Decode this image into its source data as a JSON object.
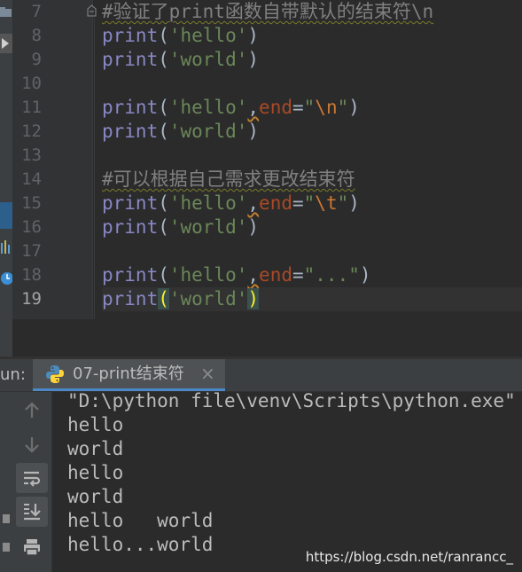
{
  "editor": {
    "line_numbers": [
      "7",
      "8",
      "9",
      "10",
      "11",
      "12",
      "13",
      "14",
      "15",
      "16",
      "17",
      "18",
      "19"
    ],
    "current_line": "19",
    "lines": [
      [
        {
          "t": "#验证了print函数自带默认的结束符\\n",
          "c": "cmt"
        }
      ],
      [
        {
          "t": "print",
          "c": "fn"
        },
        {
          "t": "(",
          "c": ""
        },
        {
          "t": "'hello'",
          "c": "str"
        },
        {
          "t": ")",
          "c": ""
        }
      ],
      [
        {
          "t": "print",
          "c": "fn"
        },
        {
          "t": "(",
          "c": ""
        },
        {
          "t": "'world'",
          "c": "str"
        },
        {
          "t": ")",
          "c": ""
        }
      ],
      [],
      [
        {
          "t": "print",
          "c": "fn"
        },
        {
          "t": "(",
          "c": ""
        },
        {
          "t": "'hello'",
          "c": "str"
        },
        {
          "t": ",",
          "c": "warn"
        },
        {
          "t": "end",
          "c": "kw"
        },
        {
          "t": "=",
          "c": ""
        },
        {
          "t": "\"",
          "c": "str"
        },
        {
          "t": "\\n",
          "c": "esc"
        },
        {
          "t": "\"",
          "c": "str"
        },
        {
          "t": ")",
          "c": ""
        }
      ],
      [
        {
          "t": "print",
          "c": "fn"
        },
        {
          "t": "(",
          "c": ""
        },
        {
          "t": "'world'",
          "c": "str"
        },
        {
          "t": ")",
          "c": ""
        }
      ],
      [],
      [
        {
          "t": "#可以根据自己需求更改结束符",
          "c": "cmt"
        }
      ],
      [
        {
          "t": "print",
          "c": "fn"
        },
        {
          "t": "(",
          "c": ""
        },
        {
          "t": "'hello'",
          "c": "str"
        },
        {
          "t": ",",
          "c": "warn"
        },
        {
          "t": "end",
          "c": "kw"
        },
        {
          "t": "=",
          "c": ""
        },
        {
          "t": "\"",
          "c": "str"
        },
        {
          "t": "\\t",
          "c": "esc"
        },
        {
          "t": "\"",
          "c": "str"
        },
        {
          "t": ")",
          "c": ""
        }
      ],
      [
        {
          "t": "print",
          "c": "fn"
        },
        {
          "t": "(",
          "c": ""
        },
        {
          "t": "'world'",
          "c": "str"
        },
        {
          "t": ")",
          "c": ""
        }
      ],
      [],
      [
        {
          "t": "print",
          "c": "fn"
        },
        {
          "t": "(",
          "c": ""
        },
        {
          "t": "'hello'",
          "c": "str"
        },
        {
          "t": ",",
          "c": "warn"
        },
        {
          "t": "end",
          "c": "kw"
        },
        {
          "t": "=",
          "c": ""
        },
        {
          "t": "\"...\"",
          "c": "str"
        },
        {
          "t": ")",
          "c": ""
        }
      ],
      [
        {
          "t": "print",
          "c": "fn"
        },
        {
          "t": "(",
          "c": "brace-match"
        },
        {
          "t": "'world'",
          "c": "str"
        },
        {
          "t": ")",
          "c": "brace-match"
        }
      ]
    ]
  },
  "run_panel": {
    "label": "un:",
    "tab_label": "07-print结束符",
    "tab_icon": "python-icon",
    "close_glyph": "×",
    "toolbar_icons": [
      "arrow-up-icon",
      "arrow-down-icon",
      "soft-wrap-icon",
      "scroll-to-end-icon",
      "print-icon"
    ]
  },
  "console": {
    "lines": [
      "\"D:\\python file\\venv\\Scripts\\python.exe\"",
      "hello",
      "world",
      "hello",
      "world",
      "hello\tworld",
      "hello...world"
    ]
  },
  "watermark": "https://blog.csdn.net/ranrancc_",
  "colors": {
    "background": "#2b2b2b",
    "function": "#8888c6",
    "string": "#6a8759",
    "keyword_arg": "#aa4926",
    "escape": "#cc7832",
    "comment": "#808080",
    "tab_underline": "#4a88c7"
  }
}
